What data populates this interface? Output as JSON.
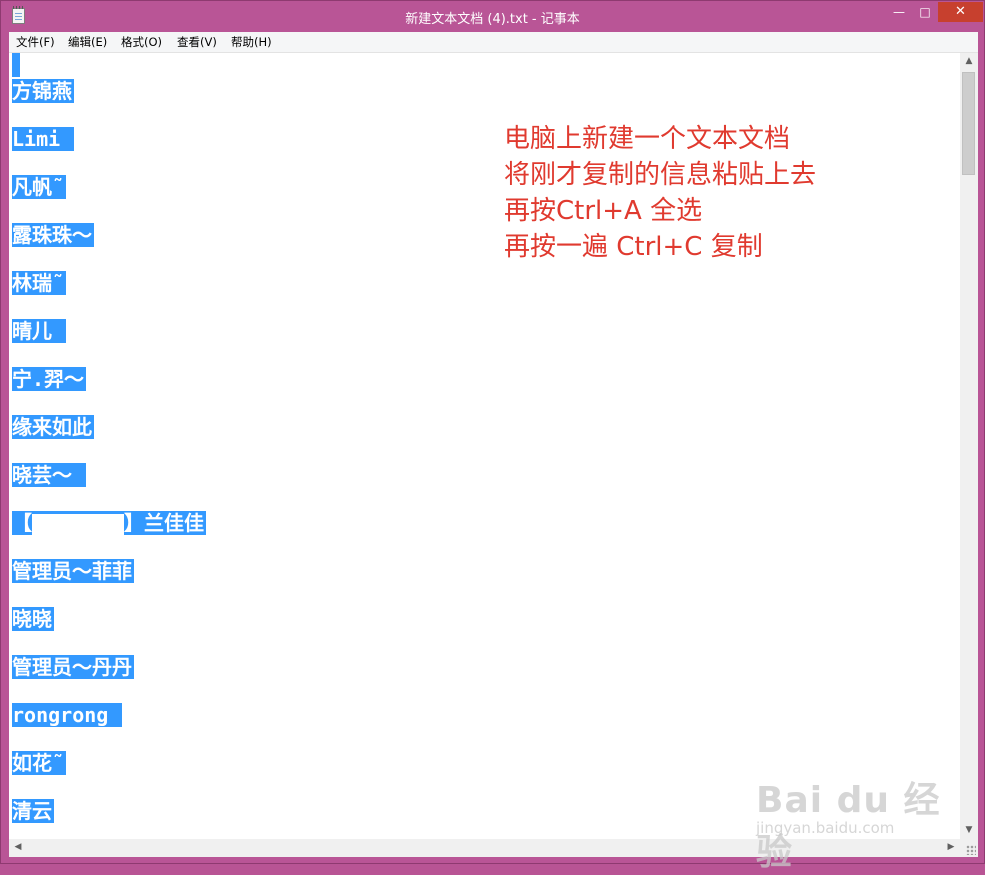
{
  "window": {
    "title": "新建文本文档 (4).txt - 记事本",
    "minimize_glyph": "—",
    "maximize_glyph": "□",
    "close_glyph": "✕"
  },
  "menu": {
    "items": [
      {
        "label": "文件(F)"
      },
      {
        "label": "编辑(E)"
      },
      {
        "label": "格式(O)"
      },
      {
        "label": "查看(V)"
      },
      {
        "label": "帮助(H)"
      }
    ]
  },
  "document": {
    "lines": [
      "方锦燕",
      "Limi ",
      "凡帆˜",
      "露珠珠～",
      "林瑞˜",
      "晴儿 ",
      "宁.羿～",
      "缘来如此",
      "晓芸～ ",
      "】兰佳佳",
      "管理员～菲菲",
      "晓晓",
      "管理员～丹丹",
      "rongrong ",
      "如花˜",
      "清云"
    ],
    "bracket_open": "【"
  },
  "annotation": {
    "lines": [
      "电脑上新建一个文本文档",
      "将刚才复制的信息粘贴上去",
      "再按Ctrl+A 全选",
      "再按一遍 Ctrl+C 复制"
    ],
    "color": "#e03a2f"
  },
  "watermark": {
    "logo": "Bai du 经验",
    "url": "jingyan.baidu.com"
  },
  "colors": {
    "titlebar": "#b95596",
    "selection": "#3399ff",
    "close_button": "#c7402e"
  }
}
